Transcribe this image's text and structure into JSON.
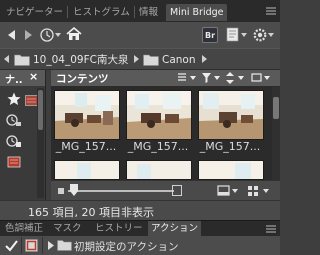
{
  "tabs": [
    {
      "label": "ナビゲーター",
      "active": false
    },
    {
      "label": "ヒストグラム",
      "active": false
    },
    {
      "label": "情報",
      "active": false
    },
    {
      "label": "Mini Bridge",
      "active": true
    }
  ],
  "toolbar": {
    "icons": [
      "back-icon",
      "forward-icon",
      "recent-items-icon",
      "home-icon",
      "bridge-icon",
      "document-icon",
      "gear-icon"
    ],
    "bridge_label": "Br"
  },
  "path": {
    "folder": "10_04_09FC南大泉",
    "subfolder": "Canon"
  },
  "left_panel": {
    "title": "ナ..",
    "close": "×"
  },
  "content": {
    "title": "コンテンツ",
    "thumbnails": [
      {
        "label": "_MG_157..."
      },
      {
        "label": "_MG_157..."
      },
      {
        "label": "_MG_157..."
      }
    ]
  },
  "status": {
    "text": "165 項目, 20 項目非表示"
  },
  "bottom_tabs": [
    {
      "label": "色調補正",
      "active": false
    },
    {
      "label": "マスク",
      "active": false
    },
    {
      "label": "ヒストリー",
      "active": false
    },
    {
      "label": "アクション",
      "active": true
    }
  ],
  "actions": {
    "set_name": "初期設定のアクション"
  },
  "colors": {
    "panel_bg": "#4c4c4c",
    "dark_bg": "#2b2b2b",
    "accent_red": "#c03b2b"
  }
}
